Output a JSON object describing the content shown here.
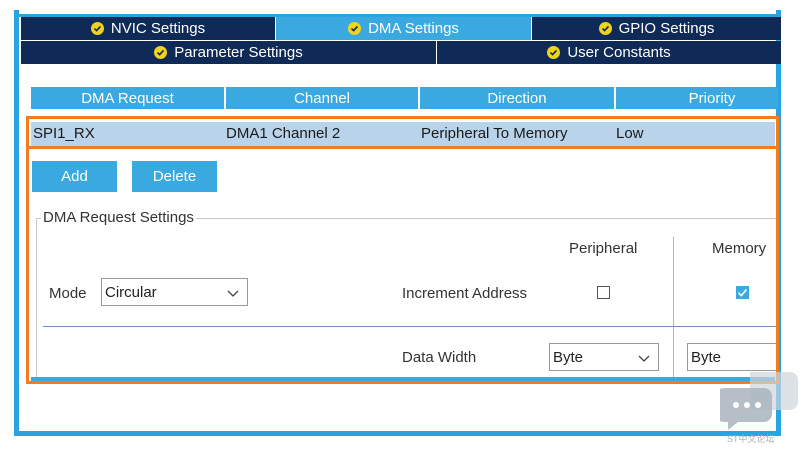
{
  "tabs_row1": [
    {
      "label": "NVIC Settings",
      "active": false
    },
    {
      "label": "DMA Settings",
      "active": true
    },
    {
      "label": "GPIO Settings",
      "active": false
    }
  ],
  "tabs_row2": [
    {
      "label": "Parameter Settings"
    },
    {
      "label": "User Constants"
    }
  ],
  "table": {
    "headers": [
      "DMA Request",
      "Channel",
      "Direction",
      "Priority"
    ],
    "rows": [
      [
        "SPI1_RX",
        "DMA1 Channel 2",
        "Peripheral To Memory",
        "Low"
      ]
    ]
  },
  "buttons": {
    "add": "Add",
    "delete": "Delete"
  },
  "settings": {
    "legend": "DMA Request Settings",
    "peripheral_label": "Peripheral",
    "memory_label": "Memory",
    "mode_label": "Mode",
    "mode_value": "Circular",
    "increment_label": "Increment Address",
    "increment_peripheral": false,
    "increment_memory": true,
    "data_width_label": "Data Width",
    "data_width_peripheral": "Byte",
    "data_width_memory": "Byte"
  },
  "watermark": "ST中文论坛",
  "colors": {
    "accent": "#3aa9e0",
    "dark_tab": "#0f2a57",
    "highlight": "#f07d22",
    "row_selected": "#b9d3ea"
  }
}
